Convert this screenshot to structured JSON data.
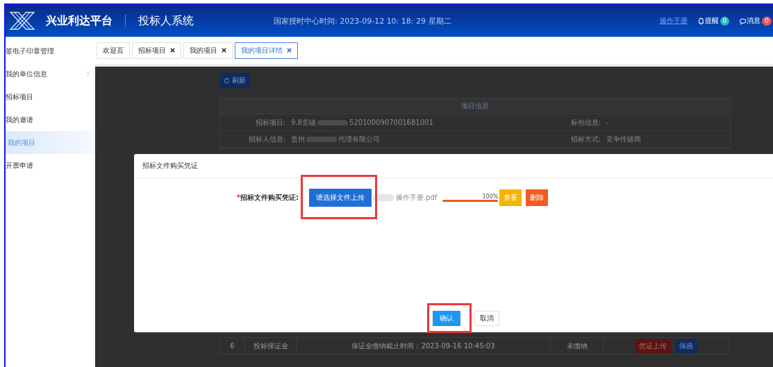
{
  "header": {
    "brand": "兴业利达平台",
    "system": "投标人系统",
    "clock": "国家授时中心时间: 2023-09-12  10: 18: 29 星期二",
    "manual_link": "操作手册",
    "reminders": {
      "label": "提醒",
      "count": "0"
    },
    "messages": {
      "label": "消息",
      "count": "0"
    }
  },
  "sidebar": {
    "items": [
      {
        "label": "签电子印章管理",
        "selected": false,
        "has_children": false
      },
      {
        "label": "我的单位信息",
        "selected": false,
        "has_children": true
      },
      {
        "label": "招标项目",
        "selected": false,
        "has_children": false
      },
      {
        "label": "我的邀请",
        "selected": false,
        "has_children": false
      },
      {
        "label": "我的项目",
        "selected": true,
        "has_children": false
      },
      {
        "label": "开票申请",
        "selected": false,
        "has_children": false
      }
    ]
  },
  "tabs": [
    {
      "label": "欢迎页",
      "selected": false,
      "closable": false
    },
    {
      "label": "招标项目",
      "selected": false,
      "closable": true
    },
    {
      "label": "我的项目",
      "selected": false,
      "closable": true
    },
    {
      "label": "我的项目详情",
      "selected": true,
      "closable": true
    }
  ],
  "background_page": {
    "refresh_button": "刷新",
    "info_title": "项目信息",
    "info_rows": [
      {
        "label": "招标项目:",
        "value_start": "9.8竞磋",
        "value_end": "5201000907001681001",
        "label_2": "标包信息:",
        "value_2": "-"
      },
      {
        "label": "招标人信息:",
        "value_start": "贵州",
        "value_end": "代理有限公司",
        "label_2": "招标方式:",
        "value_2": "竞争性磋商"
      }
    ],
    "step_rows": [
      {
        "index": "6",
        "name": "投标保证金",
        "detail": "保证金缴纳截止时间：2023-09-16 10:45:03",
        "status": "未缴纳",
        "actions": [
          "凭证上传",
          "保函"
        ]
      }
    ]
  },
  "dialog": {
    "title": "招标文件购买凭证",
    "required_mark": "*",
    "field_label": "招标文件购买凭证:",
    "upload_button": "请选择文件上传",
    "file_name": "操作手册.pdf",
    "progress": {
      "level": 1.0,
      "reading": "100%"
    },
    "view_button": "查看",
    "delete_button": "删除",
    "confirm_button": "确认",
    "cancel_button": "取消"
  }
}
